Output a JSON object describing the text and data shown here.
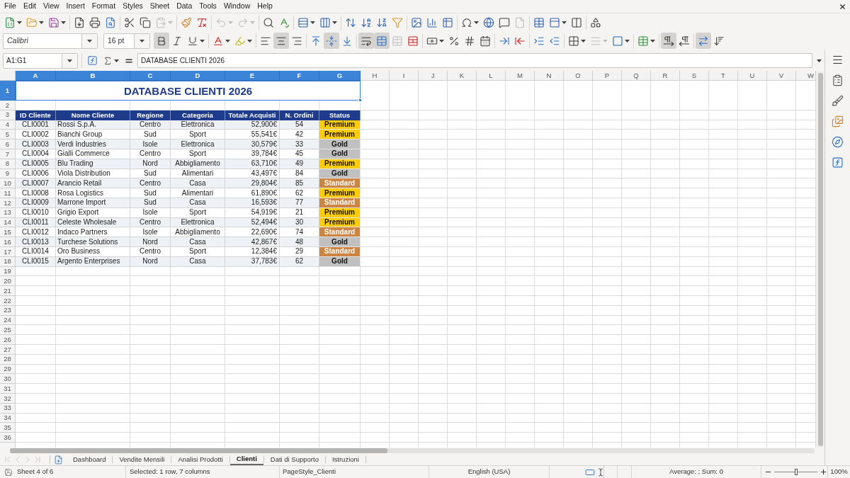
{
  "menu_bar": [
    "File",
    "Edit",
    "View",
    "Insert",
    "Format",
    "Styles",
    "Sheet",
    "Data",
    "Tools",
    "Window",
    "Help"
  ],
  "standard_toolbar": {
    "paste": {
      "disabled": true
    },
    "undo": {
      "disabled": true
    },
    "redo": {
      "disabled": true
    },
    "header_footer": {
      "disabled": true
    }
  },
  "formatting_toolbar": {
    "font_name": "Calibri",
    "font_size": "16 pt",
    "bold": {
      "pressed": true
    },
    "italic": {
      "pressed": false
    },
    "underline": {
      "pressed": false
    },
    "align_left": {
      "pressed": false
    },
    "align_center": {
      "pressed": true
    },
    "align_right": {
      "pressed": false
    },
    "align_top": {
      "pressed": false
    },
    "align_middle": {
      "pressed": true
    },
    "align_bottom": {
      "pressed": false
    },
    "wrap_text": {
      "pressed": true
    },
    "merge_and_center": {
      "pressed": true
    },
    "merge_cells": {
      "disabled": true
    },
    "border_style": {
      "disabled": true
    },
    "left_to_right": {
      "pressed": true
    },
    "right_to_left": {
      "pressed": false
    },
    "text_horizontal": {
      "pressed": true
    },
    "text_vertical": {
      "pressed": false
    }
  },
  "formula_bar": {
    "name_box": "A1:G1",
    "formula": "DATABASE CLIENTI 2026"
  },
  "sheet": {
    "columns": [
      {
        "label": "A",
        "selected": true
      },
      {
        "label": "B",
        "selected": true
      },
      {
        "label": "C",
        "selected": true
      },
      {
        "label": "D",
        "selected": true
      },
      {
        "label": "E",
        "selected": true
      },
      {
        "label": "F",
        "selected": true
      },
      {
        "label": "G",
        "selected": true
      },
      {
        "label": "H",
        "selected": false
      },
      {
        "label": "I",
        "selected": false
      },
      {
        "label": "J",
        "selected": false
      },
      {
        "label": "K",
        "selected": false
      },
      {
        "label": "L",
        "selected": false
      },
      {
        "label": "M",
        "selected": false
      },
      {
        "label": "N",
        "selected": false
      },
      {
        "label": "O",
        "selected": false
      },
      {
        "label": "P",
        "selected": false
      },
      {
        "label": "Q",
        "selected": false
      },
      {
        "label": "R",
        "selected": false
      },
      {
        "label": "S",
        "selected": false
      },
      {
        "label": "T",
        "selected": false
      },
      {
        "label": "U",
        "selected": false
      },
      {
        "label": "V",
        "selected": false
      },
      {
        "label": "W",
        "selected": false
      }
    ],
    "row_headers": [
      {
        "label": "1",
        "selected": true
      },
      {
        "label": "2",
        "selected": false
      },
      {
        "label": "3",
        "selected": false
      },
      {
        "label": "4",
        "selected": false
      },
      {
        "label": "5",
        "selected": false
      },
      {
        "label": "6",
        "selected": false
      },
      {
        "label": "7",
        "selected": false
      },
      {
        "label": "8",
        "selected": false
      },
      {
        "label": "9",
        "selected": false
      },
      {
        "label": "10",
        "selected": false
      },
      {
        "label": "11",
        "selected": false
      },
      {
        "label": "12",
        "selected": false
      },
      {
        "label": "13",
        "selected": false
      },
      {
        "label": "14",
        "selected": false
      },
      {
        "label": "15",
        "selected": false
      },
      {
        "label": "16",
        "selected": false
      },
      {
        "label": "17",
        "selected": false
      },
      {
        "label": "18",
        "selected": false
      },
      {
        "label": "19",
        "selected": false
      },
      {
        "label": "20",
        "selected": false
      },
      {
        "label": "21",
        "selected": false
      },
      {
        "label": "22",
        "selected": false
      },
      {
        "label": "23",
        "selected": false
      },
      {
        "label": "24",
        "selected": false
      },
      {
        "label": "25",
        "selected": false
      },
      {
        "label": "26",
        "selected": false
      },
      {
        "label": "27",
        "selected": false
      },
      {
        "label": "28",
        "selected": false
      },
      {
        "label": "29",
        "selected": false
      },
      {
        "label": "30",
        "selected": false
      },
      {
        "label": "31",
        "selected": false
      },
      {
        "label": "32",
        "selected": false
      },
      {
        "label": "33",
        "selected": false
      },
      {
        "label": "34",
        "selected": false
      },
      {
        "label": "35",
        "selected": false
      },
      {
        "label": "36",
        "selected": false
      }
    ],
    "title": "DATABASE CLIENTI 2026",
    "table": {
      "columns": [
        "ID Cliente",
        "Nome Cliente",
        "Regione",
        "Categoria",
        "Totale Acquisti",
        "N. Ordini",
        "Status"
      ],
      "rows": [
        {
          "cells": [
            "CLI0001",
            "Rossi S.p.A.",
            "Centro",
            "Elettronica",
            "52,900€",
            "54"
          ],
          "status": {
            "label": "Premium",
            "color": "#ffcc00"
          }
        },
        {
          "cells": [
            "CLI0002",
            "Bianchi Group",
            "Sud",
            "Sport",
            "55,541€",
            "42"
          ],
          "status": {
            "label": "Premium",
            "color": "#ffcc00"
          }
        },
        {
          "cells": [
            "CLI0003",
            "Verdi Industries",
            "Isole",
            "Elettronica",
            "30,579€",
            "33"
          ],
          "status": {
            "label": "Gold",
            "color": "#c0c0c0"
          }
        },
        {
          "cells": [
            "CLI0004",
            "Gialli Commerce",
            "Centro",
            "Sport",
            "39,784€",
            "45"
          ],
          "status": {
            "label": "Gold",
            "color": "#c0c0c0"
          }
        },
        {
          "cells": [
            "CLI0005",
            "Blu Trading",
            "Nord",
            "Abbigliamento",
            "63,710€",
            "49"
          ],
          "status": {
            "label": "Premium",
            "color": "#ffcc00"
          }
        },
        {
          "cells": [
            "CLI0006",
            "Viola Distribution",
            "Sud",
            "Alimentari",
            "43,497€",
            "84"
          ],
          "status": {
            "label": "Gold",
            "color": "#c0c0c0"
          }
        },
        {
          "cells": [
            "CLI0007",
            "Arancio Retail",
            "Centro",
            "Casa",
            "29,804€",
            "85"
          ],
          "status": {
            "label": "Standard",
            "color": "#cd853f"
          }
        },
        {
          "cells": [
            "CLI0008",
            "Rosa Logistics",
            "Sud",
            "Alimentari",
            "61,890€",
            "62"
          ],
          "status": {
            "label": "Premium",
            "color": "#ffcc00"
          }
        },
        {
          "cells": [
            "CLI0009",
            "Marrone Import",
            "Sud",
            "Casa",
            "16,593€",
            "77"
          ],
          "status": {
            "label": "Standard",
            "color": "#cd853f"
          }
        },
        {
          "cells": [
            "CLI0010",
            "Grigio Export",
            "Isole",
            "Sport",
            "54,919€",
            "21"
          ],
          "status": {
            "label": "Premium",
            "color": "#ffcc00"
          }
        },
        {
          "cells": [
            "CLI0011",
            "Celeste Wholesale",
            "Centro",
            "Elettronica",
            "52,494€",
            "30"
          ],
          "status": {
            "label": "Premium",
            "color": "#ffcc00"
          }
        },
        {
          "cells": [
            "CLI0012",
            "Indaco Partners",
            "Isole",
            "Abbigliamento",
            "22,690€",
            "74"
          ],
          "status": {
            "label": "Standard",
            "color": "#cd853f"
          }
        },
        {
          "cells": [
            "CLI0013",
            "Turchese Solutions",
            "Nord",
            "Casa",
            "42,867€",
            "48"
          ],
          "status": {
            "label": "Gold",
            "color": "#c0c0c0"
          }
        },
        {
          "cells": [
            "CLI0014",
            "Oro Business",
            "Centro",
            "Sport",
            "12,384€",
            "29"
          ],
          "status": {
            "label": "Standard",
            "color": "#cd853f"
          }
        },
        {
          "cells": [
            "CLI0015",
            "Argento Enterprises",
            "Nord",
            "Casa",
            "37,783€",
            "62"
          ],
          "status": {
            "label": "Gold",
            "color": "#c0c0c0"
          }
        }
      ]
    }
  },
  "sheet_navigation": {
    "disabled": true
  },
  "sheet_tabs": [
    {
      "label": "Dashboard",
      "selected": false
    },
    {
      "label": "Vendite Mensili",
      "selected": false
    },
    {
      "label": "Analisi Prodotti",
      "selected": false
    },
    {
      "label": "Clienti",
      "selected": true
    },
    {
      "label": "Dati di Supporto",
      "selected": false
    },
    {
      "label": "Istruzioni",
      "selected": false
    }
  ],
  "status_bar": {
    "sheet": "Sheet 4 of 6",
    "selection": "Selected: 1 row, 7 columns",
    "page_style": "PageStyle_Clienti",
    "language": "English (USA)",
    "summary": "Average: ; Sum: 0",
    "zoom": {
      "level": 0.5,
      "reading": "100%"
    }
  }
}
